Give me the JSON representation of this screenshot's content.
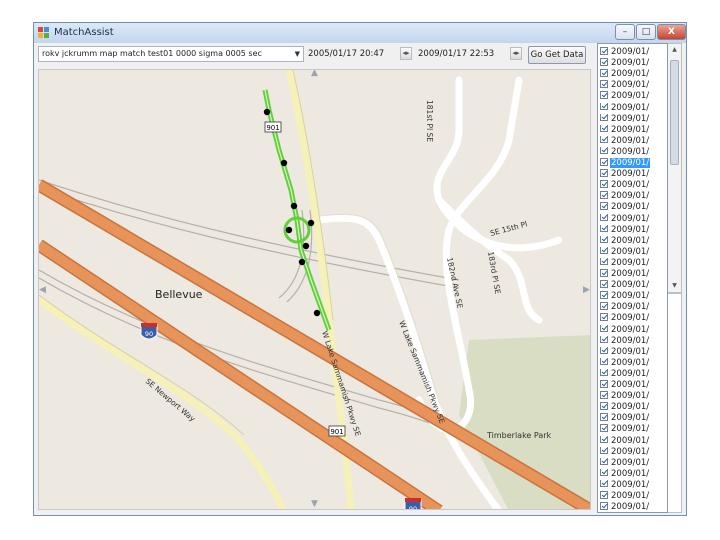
{
  "window": {
    "title": "MatchAssist",
    "controls": {
      "minimize": "–",
      "maximize": "□",
      "close": "X"
    }
  },
  "toolbar": {
    "trip_select": {
      "value": "rokv jckrumm map match test01 0000 sigma 0005 sec"
    },
    "start_time": "2005/01/17 20:47",
    "end_time": "2009/01/17 22:53",
    "go_button": "Go Get Data"
  },
  "map": {
    "labels": {
      "city": "Bellevue",
      "park": "Timberlake Park",
      "road_lake_sammamish_1": "W Lake Sammamish Pkwy SE",
      "road_lake_sammamish_2": "W Lake Sammamish Pkwy SE",
      "road_se_newport": "SE Newport Way",
      "road_181st": "181st Pl SE",
      "road_182nd": "182nd Ave SE",
      "road_se15th": "SE 15th Pl",
      "road_183rd": "183rd Pl SE",
      "shield_901_top": "901",
      "shield_901_bottom": "901",
      "shield_90_a": "90",
      "shield_90_b": "90"
    },
    "colors": {
      "background": "#ede9e0",
      "park": "#d8ddc3",
      "interstate": "#e8935a",
      "route": "#60cf3a",
      "road_white": "#ffffff",
      "road_yellow": "#f6f1b9",
      "gps_point": "#000000"
    }
  },
  "list": {
    "scroll_up": "▲",
    "scroll_down": "▼",
    "items": [
      "2009/01/",
      "2009/01/",
      "2009/01/",
      "2009/01/",
      "2009/01/",
      "2009/01/",
      "2009/01/",
      "2009/01/",
      "2009/01/",
      "2009/01/",
      "2009/01/",
      "2009/01/",
      "2009/01/",
      "2009/01/",
      "2009/01/",
      "2009/01/",
      "2009/01/",
      "2009/01/",
      "2009/01/",
      "2009/01/",
      "2009/01/",
      "2009/01/",
      "2009/01/",
      "2009/01/",
      "2009/01/",
      "2009/01/",
      "2009/01/",
      "2009/01/",
      "2009/01/",
      "2009/01/",
      "2009/01/",
      "2009/01/",
      "2009/01/",
      "2009/01/",
      "2009/01/",
      "2009/01/",
      "2009/01/",
      "2009/01/",
      "2009/01/",
      "2009/01/",
      "2009/01/",
      "2009/01/"
    ],
    "selected_index": 10
  }
}
